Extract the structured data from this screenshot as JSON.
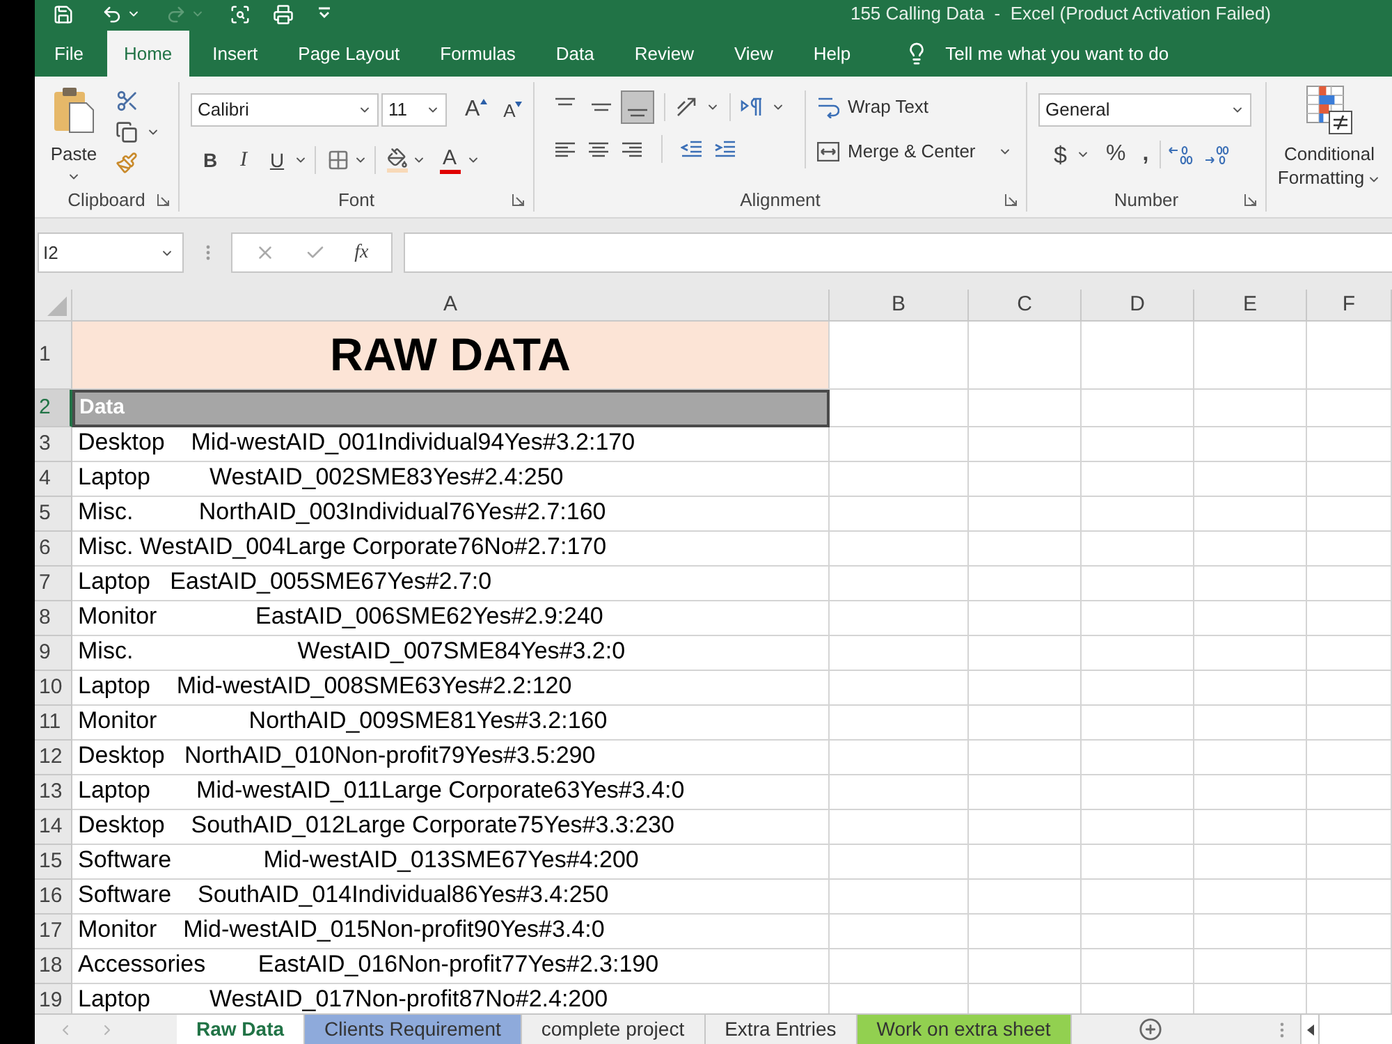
{
  "title_bar": {
    "title": "155 Calling Data  -  Excel (Product Activation Failed)"
  },
  "quick_access": {
    "redo": {
      "disabled": true
    }
  },
  "ribbon_tabs": [
    {
      "label": "File",
      "selected": false
    },
    {
      "label": "Home",
      "selected": true
    },
    {
      "label": "Insert",
      "selected": false
    },
    {
      "label": "Page Layout",
      "selected": false
    },
    {
      "label": "Formulas",
      "selected": false
    },
    {
      "label": "Data",
      "selected": false
    },
    {
      "label": "Review",
      "selected": false
    },
    {
      "label": "View",
      "selected": false
    },
    {
      "label": "Help",
      "selected": false
    }
  ],
  "tell_me": {
    "placeholder": "Tell me what you want to do"
  },
  "ribbon": {
    "clipboard": {
      "paste": "Paste",
      "label": "Clipboard"
    },
    "font": {
      "font_name": "Calibri",
      "font_size": "11",
      "grow_font": "A",
      "shrink_font": "A",
      "bold": "B",
      "italic": "I",
      "underline": "U",
      "font_color": "A",
      "label": "Font"
    },
    "alignment": {
      "vertical_align": [
        {
          "kind": "top",
          "selected": false
        },
        {
          "kind": "middle",
          "selected": false
        },
        {
          "kind": "bottom",
          "selected": true
        }
      ],
      "wrap_text": "Wrap Text",
      "merge_center": "Merge & Center",
      "label": "Alignment"
    },
    "number": {
      "format": "General",
      "currency": "$",
      "percent": "%",
      "comma": ",",
      "label": "Number"
    },
    "styles": {
      "conditional_formatting": "Conditional Formatting"
    }
  },
  "formula_bar": {
    "name_box": "I2",
    "insert_function": "fx"
  },
  "sheet": {
    "columns": [
      "A",
      "B",
      "C",
      "D",
      "E",
      "F"
    ],
    "rows": [
      {
        "number": "1",
        "kind": "title",
        "text": "RAW DATA",
        "selected": false
      },
      {
        "number": "2",
        "kind": "header",
        "text": "Data",
        "selected": true
      },
      {
        "number": "3",
        "kind": "data",
        "text": "Desktop    Mid-westAID_001Individual94Yes#3.2:170",
        "selected": false
      },
      {
        "number": "4",
        "kind": "data",
        "text": "Laptop         WestAID_002SME83Yes#2.4:250",
        "selected": false
      },
      {
        "number": "5",
        "kind": "data",
        "text": "Misc.          NorthAID_003Individual76Yes#2.7:160",
        "selected": false
      },
      {
        "number": "6",
        "kind": "data",
        "text": "Misc. WestAID_004Large Corporate76No#2.7:170",
        "selected": false
      },
      {
        "number": "7",
        "kind": "data",
        "text": "Laptop   EastAID_005SME67Yes#2.7:0",
        "selected": false
      },
      {
        "number": "8",
        "kind": "data",
        "text": "Monitor               EastAID_006SME62Yes#2.9:240",
        "selected": false
      },
      {
        "number": "9",
        "kind": "data",
        "text": "Misc.                         WestAID_007SME84Yes#3.2:0",
        "selected": false
      },
      {
        "number": "10",
        "kind": "data",
        "text": "Laptop    Mid-westAID_008SME63Yes#2.2:120",
        "selected": false
      },
      {
        "number": "11",
        "kind": "data",
        "text": "Monitor              NorthAID_009SME81Yes#3.2:160",
        "selected": false
      },
      {
        "number": "12",
        "kind": "data",
        "text": "Desktop   NorthAID_010Non-profit79Yes#3.5:290",
        "selected": false
      },
      {
        "number": "13",
        "kind": "data",
        "text": "Laptop       Mid-westAID_011Large Corporate63Yes#3.4:0",
        "selected": false
      },
      {
        "number": "14",
        "kind": "data",
        "text": "Desktop    SouthAID_012Large Corporate75Yes#3.3:230",
        "selected": false
      },
      {
        "number": "15",
        "kind": "data",
        "text": "Software              Mid-westAID_013SME67Yes#4:200",
        "selected": false
      },
      {
        "number": "16",
        "kind": "data",
        "text": "Software    SouthAID_014Individual86Yes#3.4:250",
        "selected": false
      },
      {
        "number": "17",
        "kind": "data",
        "text": "Monitor    Mid-westAID_015Non-profit90Yes#3.4:0",
        "selected": false
      },
      {
        "number": "18",
        "kind": "data",
        "text": "Accessories        EastAID_016Non-profit77Yes#2.3:190",
        "selected": false
      },
      {
        "number": "19",
        "kind": "data",
        "text": "Laptop         WestAID_017Non-profit87No#2.4:200",
        "selected": false
      }
    ]
  },
  "sheet_tabs": [
    {
      "label": "Raw Data",
      "selected": true
    },
    {
      "label": "Clients Requirement",
      "selected": false,
      "color": "#8eaadb"
    },
    {
      "label": "complete project",
      "selected": false
    },
    {
      "label": "Extra Entries",
      "selected": false
    },
    {
      "label": "Work on extra sheet",
      "selected": false,
      "color": "#92d050"
    }
  ]
}
